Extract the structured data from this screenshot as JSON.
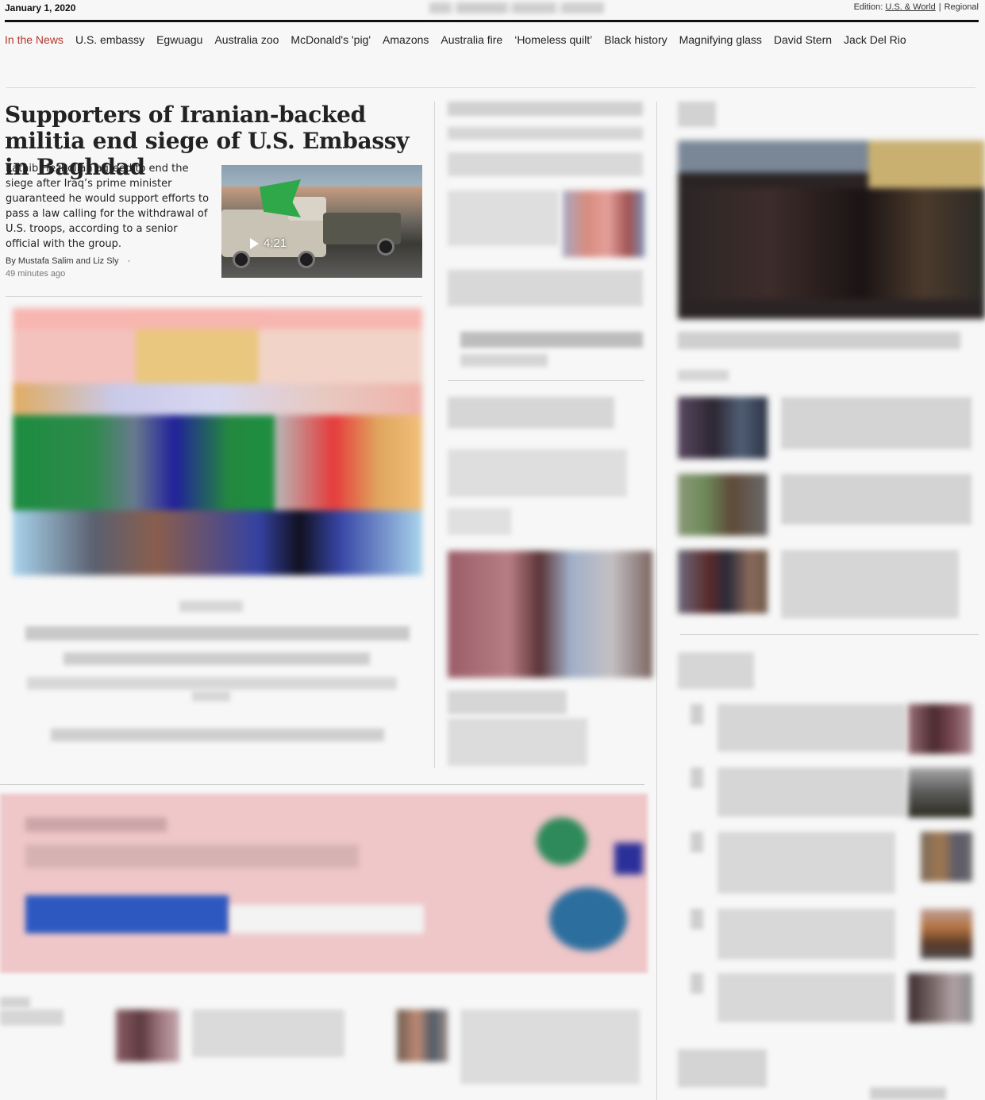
{
  "header": {
    "date": "January 1, 2020",
    "edition_label": "Edition:",
    "edition_us_world": "U.S. & World",
    "edition_separator": "|",
    "edition_regional": "Regional"
  },
  "in_the_news": {
    "label": "In the News",
    "items": [
      "U.S. embassy",
      "Egwuagu",
      "Australia zoo",
      "McDonald's 'pig'",
      "Amazons",
      "Australia fire",
      "‘Homeless quilt’",
      "Black history",
      "Magnifying glass",
      "David Stern",
      "Jack Del Rio"
    ]
  },
  "lead_story": {
    "headline": "Supporters of Iranian-backed militia end siege of U.S. Embassy in Baghdad",
    "blurb": "Kataib Hezbollah agreed to end the siege after Iraq’s prime minister guaranteed he would support efforts to pass a law calling for the withdrawal of U.S. troops, according to a senior official with the group.",
    "byline_prefix": "By",
    "author_1": "Mustafa Salim",
    "byline_and": "and",
    "author_2": "Liz Sly",
    "byline_dot": "·",
    "timestamp": "49 minutes ago",
    "video_duration": "4:21"
  },
  "icons": {
    "play": "play-icon"
  },
  "colors": {
    "news_label": "#b03a2e",
    "rule": "#111111",
    "promo_bg": "#efc7c9"
  }
}
